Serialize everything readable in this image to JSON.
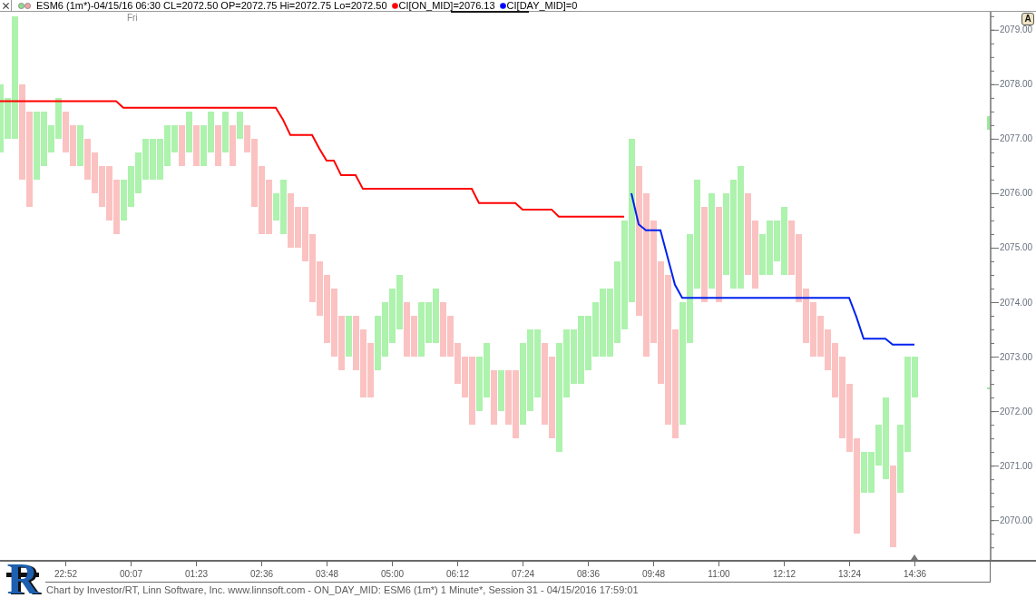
{
  "header": {
    "legend": [
      {
        "color": "#8fdc8f"
      },
      {
        "color": "#f0a4a4"
      }
    ],
    "title": "ESM6 (1m*)-04/15/16 06:30 CL=2072.50 OP=2072.75 Hi=2072.75 Lo=2072.50",
    "studies": [
      {
        "text": "CI[ON_MID]=2076.13",
        "color": "#ff0000"
      },
      {
        "text": "CI[DAY_MID]=0",
        "color": "#0000ff"
      }
    ]
  },
  "chart": {
    "autoscale_button": "A",
    "chart_data": {
      "type": "line",
      "ylim": [
        2069.27,
        2079.33
      ],
      "categories": [
        null,
        null,
        null,
        null,
        null,
        null,
        null,
        null,
        null,
        "22:52",
        null,
        null,
        null,
        null,
        null,
        null,
        null,
        null,
        "00:07",
        null,
        null,
        null,
        null,
        null,
        null,
        null,
        null,
        "01:23",
        null,
        null,
        null,
        null,
        null,
        null,
        null,
        null,
        "02:36",
        null,
        null,
        null,
        null,
        null,
        null,
        null,
        null,
        "03:48",
        null,
        null,
        null,
        null,
        null,
        null,
        null,
        null,
        "05:00",
        null,
        null,
        null,
        null,
        null,
        null,
        null,
        null,
        "06:12",
        null,
        null,
        null,
        null,
        null,
        null,
        null,
        null,
        "07:24",
        null,
        null,
        null,
        null,
        null,
        null,
        null,
        null,
        "08:36",
        null,
        null,
        null,
        null,
        null,
        null,
        null,
        null,
        "09:48",
        null,
        null,
        null,
        null,
        null,
        null,
        null,
        null,
        "11:00",
        null,
        null,
        null,
        null,
        null,
        null,
        null,
        null,
        "12:12",
        null,
        null,
        null,
        null,
        null,
        null,
        null,
        null,
        "13:24",
        null,
        null,
        null,
        null,
        null,
        null,
        null,
        null,
        "14:36",
        null,
        null,
        null,
        null,
        null,
        null,
        null,
        null,
        null,
        null
      ],
      "series": [
        {
          "color": "#ff0000",
          "values": [
            2077.69,
            2077.69,
            2077.69,
            2077.69,
            2077.69,
            2077.69,
            2077.69,
            2077.69,
            2077.69,
            2077.69,
            2077.69,
            2077.69,
            2077.69,
            2077.69,
            2077.69,
            2077.69,
            2077.69,
            2077.57,
            2077.57,
            2077.57,
            2077.57,
            2077.57,
            2077.57,
            2077.57,
            2077.57,
            2077.57,
            2077.57,
            2077.57,
            2077.57,
            2077.57,
            2077.57,
            2077.57,
            2077.57,
            2077.57,
            2077.57,
            2077.57,
            2077.57,
            2077.57,
            2077.57,
            2077.35,
            2077.07,
            2077.07,
            2077.07,
            2077.07,
            2076.82,
            2076.6,
            2076.6,
            2076.33,
            2076.33,
            2076.33,
            2076.08,
            2076.08,
            2076.08,
            2076.08,
            2076.08,
            2076.08,
            2076.08,
            2076.08,
            2076.08,
            2076.08,
            2076.08,
            2076.08,
            2076.08,
            2076.08,
            2076.08,
            2076.08,
            2075.82,
            2075.82,
            2075.82,
            2075.82,
            2075.82,
            2075.82,
            2075.7,
            2075.7,
            2075.7,
            2075.7,
            2075.7,
            2075.57,
            2075.57,
            2075.57,
            2075.57,
            2075.57,
            2075.57,
            2075.57,
            2075.57,
            2075.57,
            2075.57,
            null,
            null,
            null,
            null,
            null,
            null,
            null,
            null,
            null,
            null,
            null,
            null,
            null,
            null,
            null,
            null,
            null,
            null,
            null,
            null,
            null,
            null,
            null,
            null,
            null,
            null,
            null,
            null,
            null,
            null,
            null,
            null,
            null,
            null,
            null,
            null,
            null,
            null,
            null,
            null,
            null,
            null,
            null,
            null,
            null,
            null,
            null,
            null,
            null,
            null
          ]
        },
        {
          "color": "#0022ee",
          "values": [
            null,
            null,
            null,
            null,
            null,
            null,
            null,
            null,
            null,
            null,
            null,
            null,
            null,
            null,
            null,
            null,
            null,
            null,
            null,
            null,
            null,
            null,
            null,
            null,
            null,
            null,
            null,
            null,
            null,
            null,
            null,
            null,
            null,
            null,
            null,
            null,
            null,
            null,
            null,
            null,
            null,
            null,
            null,
            null,
            null,
            null,
            null,
            null,
            null,
            null,
            null,
            null,
            null,
            null,
            null,
            null,
            null,
            null,
            null,
            null,
            null,
            null,
            null,
            null,
            null,
            null,
            null,
            null,
            null,
            null,
            null,
            null,
            null,
            null,
            null,
            null,
            null,
            null,
            null,
            null,
            null,
            null,
            null,
            null,
            null,
            null,
            null,
            2076,
            2075.43,
            2075.32,
            2075.32,
            2075.32,
            2074.82,
            2074.32,
            2074.08,
            2074.08,
            2074.08,
            2074.08,
            2074.08,
            2074.08,
            2074.08,
            2074.08,
            2074.08,
            2074.08,
            2074.08,
            2074.08,
            2074.08,
            2074.08,
            2074.08,
            2074.08,
            2074.08,
            2074.08,
            2074.08,
            2074.08,
            2074.08,
            2074.08,
            2074.08,
            2074.08,
            2073.73,
            2073.33,
            2073.33,
            2073.33,
            2073.33,
            2073.22,
            2073.22,
            2073.22,
            2073.22,
            null,
            null,
            null,
            null,
            null,
            null,
            null,
            null,
            null,
            null
          ]
        }
      ],
      "yticks": [
        {
          "value": 2070,
          "label": "2070.00"
        },
        {
          "value": 2071,
          "label": "2071.00"
        },
        {
          "value": 2072,
          "label": "2072.00"
        },
        {
          "value": 2073,
          "label": "2073.00"
        },
        {
          "value": 2074,
          "label": "2074.00"
        },
        {
          "value": 2075,
          "label": "2075.00"
        },
        {
          "value": 2076,
          "label": "2076.00"
        },
        {
          "value": 2077,
          "label": "2077.00"
        },
        {
          "value": 2078,
          "label": "2078.00"
        },
        {
          "value": 2079,
          "label": "2079.00"
        }
      ],
      "annotations": [
        "Fri"
      ]
    }
  },
  "logo": "R",
  "footer": "Chart by Investor/RT, Linn Software, Inc. www.linnsoft.com - ON_DAY_MID: ESM6 (1m*) 1 Minute*, Session 31 - 04/15/2016 17:59:01"
}
